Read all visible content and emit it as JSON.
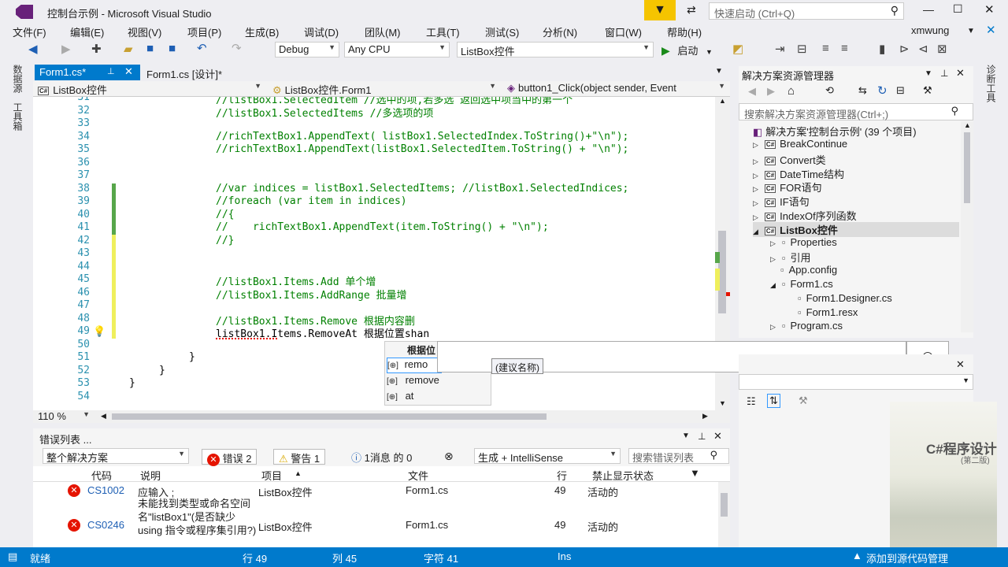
{
  "titlebar": {
    "title": "控制台示例 - Microsoft Visual Studio",
    "quick_launch_placeholder": "快速启动 (Ctrl+Q)"
  },
  "menu": [
    "文件(F)",
    "编辑(E)",
    "视图(V)",
    "项目(P)",
    "生成(B)",
    "调试(D)",
    "团队(M)",
    "工具(T)",
    "测试(S)",
    "分析(N)",
    "窗口(W)",
    "帮助(H)"
  ],
  "user": "xmwung",
  "toolbar": {
    "config": "Debug",
    "platform": "Any CPU",
    "project": "ListBox控件",
    "start_label": "启动"
  },
  "leftstrip": [
    "数据源",
    "工具箱"
  ],
  "rightstrip": [
    "诊断工具"
  ],
  "tabs": [
    {
      "label": "Form1.cs*"
    },
    {
      "label": "Form1.cs [设计]*"
    }
  ],
  "navbar": {
    "project": "ListBox控件",
    "class": "ListBox控件.Form1",
    "member": "button1_Click(object sender, Event"
  },
  "editor": {
    "lines": [
      {
        "n": "31",
        "text": "//listBox1.SelectedItem //选中的项,若多选 返回选中项当中的第一个",
        "kind": "comment"
      },
      {
        "n": "32",
        "text": "//listBox1.SelectedItems //多选项的项",
        "kind": "comment"
      },
      {
        "n": "33",
        "text": "",
        "kind": "comment"
      },
      {
        "n": "34",
        "text": "//richTextBox1.AppendText( listBox1.SelectedIndex.ToString()+\"\\n\");",
        "kind": "comment"
      },
      {
        "n": "35",
        "text": "//richTextBox1.AppendText(listBox1.SelectedItem.ToString() + \"\\n\");",
        "kind": "comment"
      },
      {
        "n": "36",
        "text": "",
        "kind": "comment"
      },
      {
        "n": "37",
        "text": "",
        "kind": "comment"
      },
      {
        "n": "38",
        "text": "//var indices = listBox1.SelectedItems; //listBox1.SelectedIndices;",
        "kind": "comment"
      },
      {
        "n": "39",
        "text": "//foreach (var item in indices)",
        "kind": "comment"
      },
      {
        "n": "40",
        "text": "//{",
        "kind": "comment"
      },
      {
        "n": "41",
        "text": "//    richTextBox1.AppendText(item.ToString() + \"\\n\");",
        "kind": "comment"
      },
      {
        "n": "42",
        "text": "//}",
        "kind": "comment"
      },
      {
        "n": "43",
        "text": "",
        "kind": "comment"
      },
      {
        "n": "44",
        "text": "",
        "kind": "comment"
      },
      {
        "n": "45",
        "text": "//listBox1.Items.Add 单个增",
        "kind": "comment"
      },
      {
        "n": "46",
        "text": "//listBox1.Items.AddRange 批量增",
        "kind": "comment"
      },
      {
        "n": "47",
        "text": "",
        "kind": "comment"
      },
      {
        "n": "48",
        "text": "//listBox1.Items.Remove 根据内容删",
        "kind": "comment"
      },
      {
        "n": "49",
        "text": "listBox1.Items.RemoveAt 根据位置shan",
        "kind": "plain"
      },
      {
        "n": "50",
        "text": "",
        "kind": "plain"
      },
      {
        "n": "51",
        "text": "}",
        "kind": "plain"
      },
      {
        "n": "52",
        "text": "}",
        "kind": "plain"
      },
      {
        "n": "53",
        "text": "}",
        "kind": "plain"
      },
      {
        "n": "54",
        "text": "",
        "kind": "plain"
      }
    ],
    "zoom": "110 %"
  },
  "autocomplete": {
    "header": "根据位",
    "items": [
      "remo",
      "remove",
      "at"
    ]
  },
  "ime_input": {
    "value": "",
    "tooltip": "(建议名称)",
    "emoji_icon": "smiley-icon"
  },
  "errors": {
    "title": "错误列表 ...",
    "scope": "整个解决方案",
    "errors_btn": "错误 2",
    "warnings_btn": "警告 1",
    "messages_btn": "1消息 的 0",
    "build_filter": "生成 + IntelliSense",
    "search_placeholder": "搜索错误列表",
    "columns": [
      "代码",
      "说明",
      "项目",
      "文件",
      "行",
      "禁止显示状态"
    ],
    "rows": [
      {
        "code": "CS1002",
        "desc": "应输入 ;",
        "project": "ListBox控件",
        "file": "Form1.cs",
        "line": "49",
        "state": "活动的"
      },
      {
        "code": "CS0246",
        "desc": "未能找到类型或命名空间名\"listBox1\"(是否缺少 using 指令或程序集引用?)",
        "project": "ListBox控件",
        "file": "Form1.cs",
        "line": "49",
        "state": "活动的"
      }
    ]
  },
  "solution": {
    "title": "解决方案资源管理器",
    "search_placeholder": "搜索解决方案资源管理器(Ctrl+;)",
    "root": "解决方案'控制台示例' (39 个项目)",
    "items": [
      {
        "label": "BreakContinue",
        "level": 1
      },
      {
        "label": "Convert类",
        "level": 1
      },
      {
        "label": "DateTime结构",
        "level": 1
      },
      {
        "label": "FOR语句",
        "level": 1
      },
      {
        "label": "IF语句",
        "level": 1
      },
      {
        "label": "IndexOf序列函数",
        "level": 1
      },
      {
        "label": "ListBox控件",
        "level": 1
      },
      {
        "label": "Properties",
        "level": 2
      },
      {
        "label": "引用",
        "level": 2
      },
      {
        "label": "App.config",
        "level": 2
      },
      {
        "label": "Form1.cs",
        "level": 2
      },
      {
        "label": "Form1.Designer.cs",
        "level": 3
      },
      {
        "label": "Form1.resx",
        "level": 3
      },
      {
        "label": "Program.cs",
        "level": 2
      }
    ]
  },
  "statusbar": {
    "ready": "就绪",
    "line": "行 49",
    "col": "列 45",
    "char": "字符 41",
    "mode": "Ins",
    "add_source": "添加到源代码管理"
  },
  "book": {
    "title": "C#程序设计",
    "edition": "(第二版)"
  },
  "colors": {
    "accent": "#007acc",
    "comment": "#008000",
    "line_number": "#2b91af",
    "error": "#e51400"
  }
}
